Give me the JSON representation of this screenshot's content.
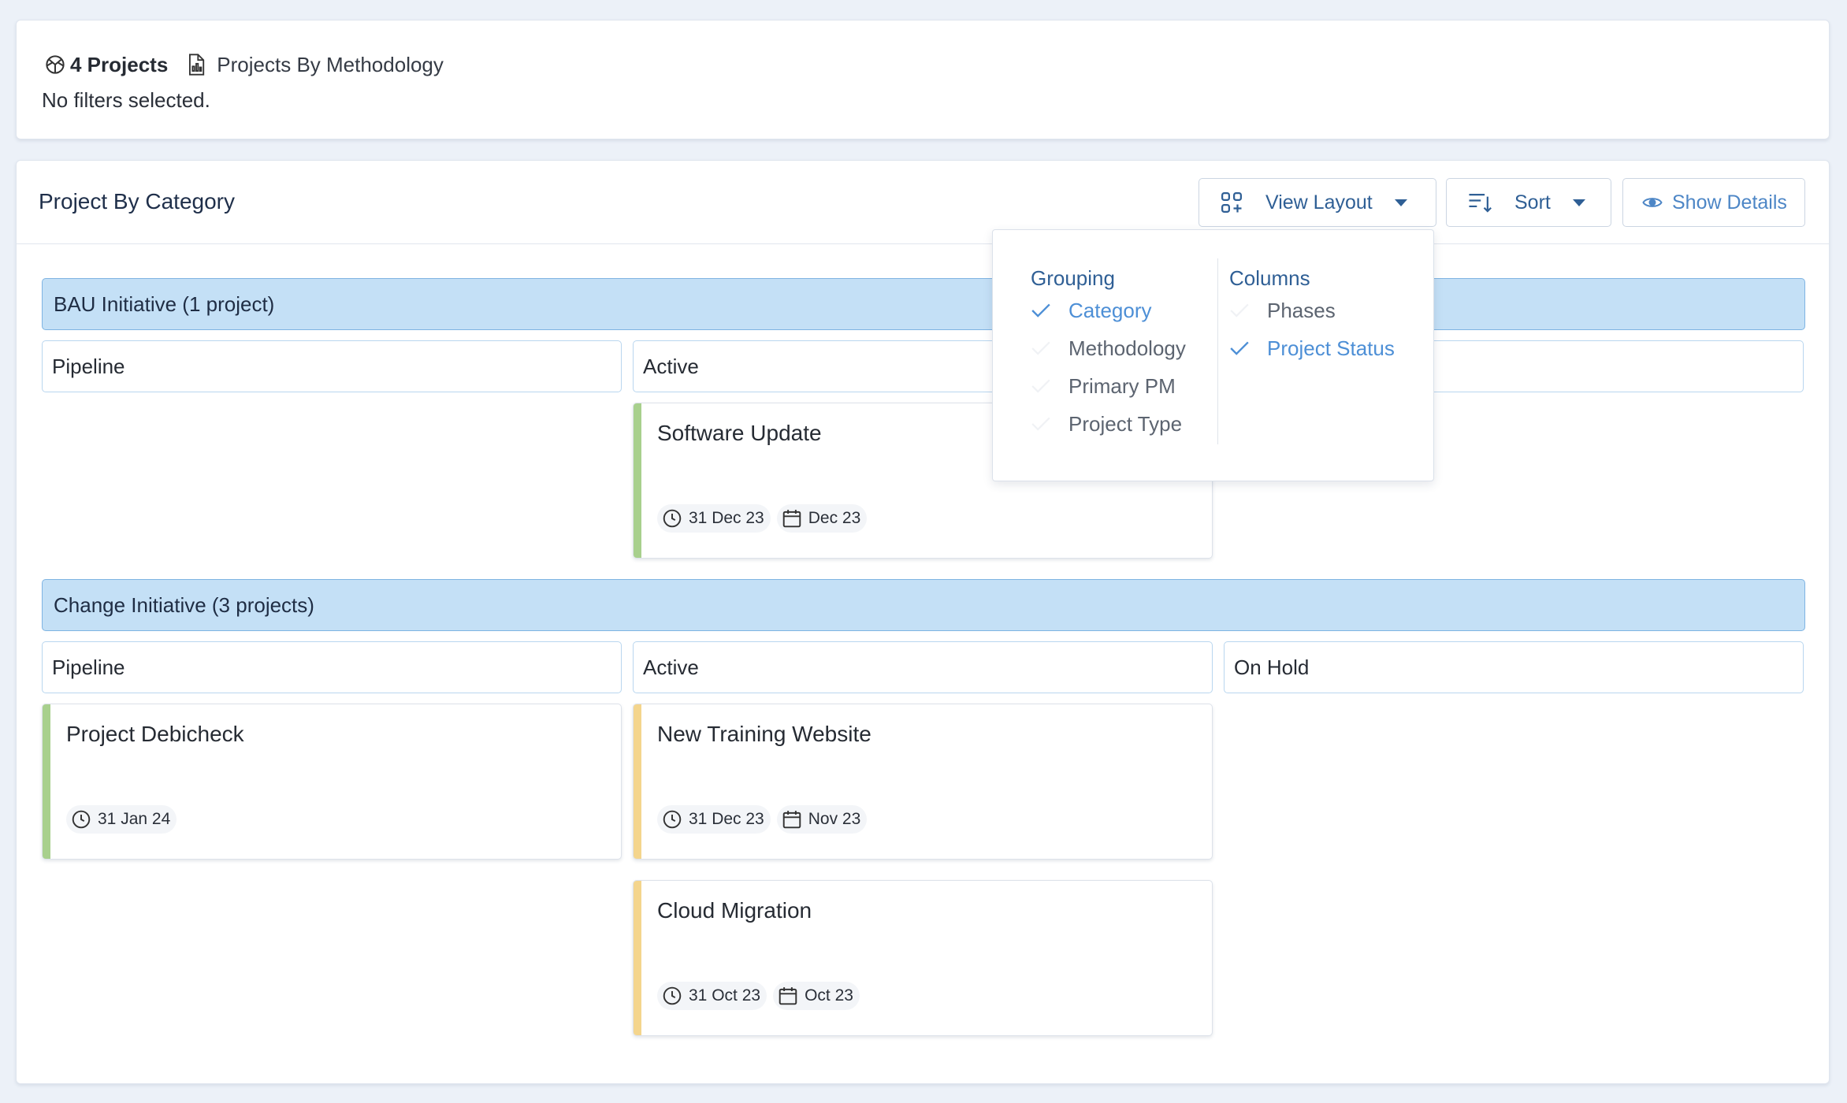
{
  "summary": {
    "count_label": "4 Projects",
    "methodology_label": "Projects By Methodology",
    "filters_text": "No filters selected."
  },
  "board": {
    "title": "Project By Category",
    "view_layout_label": "View Layout",
    "sort_label": "Sort",
    "show_details_label": "Show Details"
  },
  "groups": [
    {
      "label": "BAU Initiative (1 project)",
      "columns": [
        "Pipeline",
        "Active",
        ""
      ],
      "projects": [
        {
          "name": "Software Update",
          "status": "Active",
          "color": "#a8d08d",
          "due": "31 Dec 23",
          "period": "Dec 23"
        }
      ]
    },
    {
      "label": "Change Initiative (3 projects)",
      "columns": [
        "Pipeline",
        "Active",
        "On Hold"
      ],
      "projects": [
        {
          "name": "Project Debicheck",
          "status": "Pipeline",
          "color": "#a8d08d",
          "due": "31 Jan 24"
        },
        {
          "name": "New Training Website",
          "status": "Active",
          "color": "#f4d58d",
          "due": "31 Dec 23",
          "period": "Nov 23"
        },
        {
          "name": "Cloud Migration",
          "status": "Active",
          "color": "#f4d58d",
          "due": "31 Oct 23",
          "period": "Oct 23"
        }
      ]
    }
  ],
  "layout_popup": {
    "grouping": {
      "title": "Grouping",
      "options": [
        {
          "label": "Category",
          "checked": true
        },
        {
          "label": "Methodology",
          "checked": false
        },
        {
          "label": "Primary PM",
          "checked": false
        },
        {
          "label": "Project Type",
          "checked": false
        }
      ]
    },
    "columns": {
      "title": "Columns",
      "options": [
        {
          "label": "Phases",
          "checked": false
        },
        {
          "label": "Project Status",
          "checked": true
        }
      ]
    }
  },
  "colors": {
    "accent": "#2f5f95",
    "accent_light": "#4d8fd6",
    "group_bar": "#c4e0f6",
    "green": "#a8d08d",
    "yellow": "#f4d58d"
  }
}
